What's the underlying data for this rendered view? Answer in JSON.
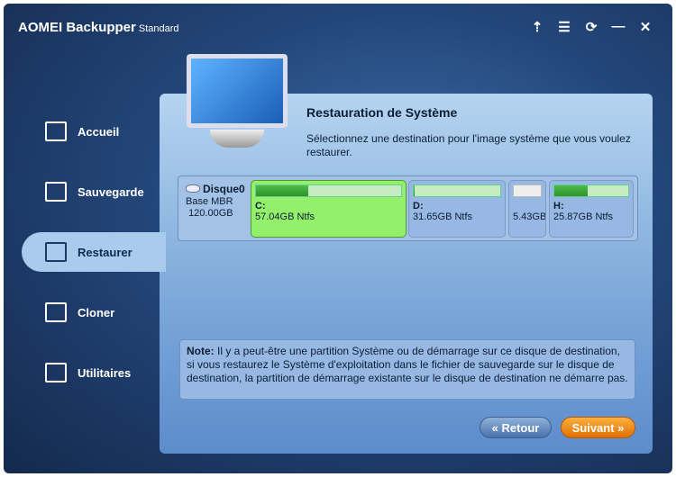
{
  "app": {
    "title": "AOMEI Backupper",
    "edition": "Standard"
  },
  "window_controls": [
    "upgrade-icon",
    "menu-icon",
    "refresh-icon",
    "minimize-icon",
    "close-icon"
  ],
  "sidebar": {
    "items": [
      {
        "label": "Accueil",
        "icon": "home-icon"
      },
      {
        "label": "Sauvegarde",
        "icon": "backup-icon"
      },
      {
        "label": "Restaurer",
        "icon": "restore-icon",
        "active": true
      },
      {
        "label": "Cloner",
        "icon": "clone-icon"
      },
      {
        "label": "Utilitaires",
        "icon": "tools-icon"
      }
    ]
  },
  "main": {
    "title": "Restauration de Système",
    "description": "Sélectionnez une destination pour l'image système que vous voulez restaurer.",
    "disk": {
      "name": "Disque0",
      "type": "Base MBR",
      "size": "120.00GB",
      "partitions": [
        {
          "letter": "C:",
          "info": "57.04GB Ntfs",
          "used": 0.36,
          "selected": true
        },
        {
          "letter": "D:",
          "info": "31.65GB Ntfs",
          "used": 0.01
        },
        {
          "letter": "",
          "info": "5.43GB",
          "used": 0
        },
        {
          "letter": "H:",
          "info": "25.87GB Ntfs",
          "used": 0.45
        }
      ]
    },
    "note_label": "Note:",
    "note": " Il y a peut-être une partition Système ou de démarrage sur ce disque de destination, si vous restaurez le Système d'exploitation dans le fichier de sauvegarde sur le disque de destination, la partition de démarrage existante sur le disque de destination ne démarre pas.",
    "back_label": "« Retour",
    "next_label": "Suivant »"
  }
}
